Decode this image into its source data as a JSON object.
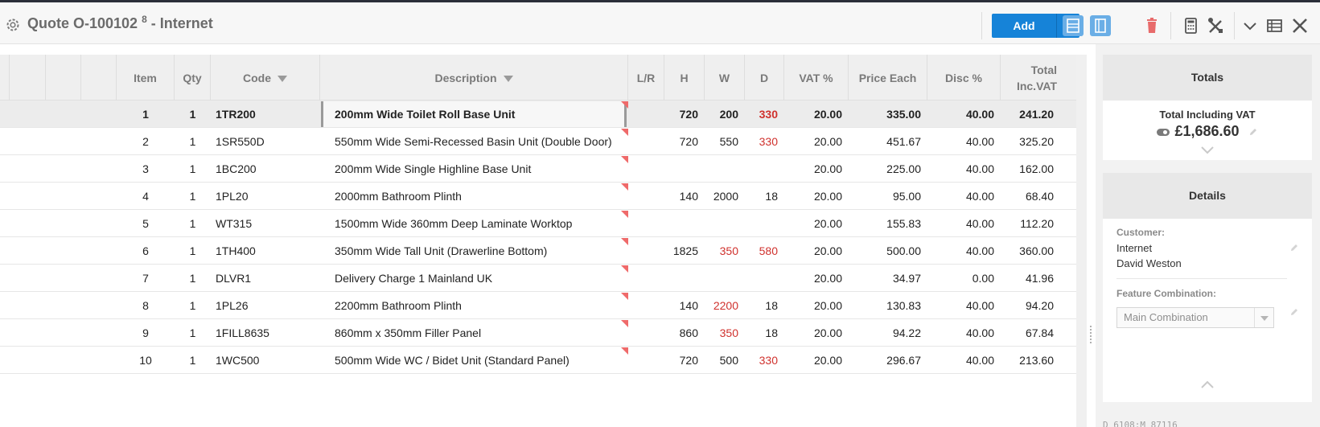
{
  "header": {
    "title": "Quote O-100102",
    "title_sup": "8",
    "title_suffix": "- Internet",
    "add_label": "Add"
  },
  "colors": {
    "accent": "#1683d8",
    "danger_icon": "#e86b6b",
    "highlight_text": "#d0312d"
  },
  "icons": [
    "gear-icon",
    "chevron-down-icon",
    "layout-icon",
    "door-icon",
    "trash-icon",
    "calculator-icon",
    "tools-icon",
    "chevron-down-icon",
    "table-icon",
    "close-icon",
    "pencil-icon",
    "toggle-icon",
    "chevron-up-icon"
  ],
  "grid": {
    "columns": {
      "item": "Item",
      "qty": "Qty",
      "code": "Code",
      "description": "Description",
      "lr": "L/R",
      "h": "H",
      "w": "W",
      "d": "D",
      "vat": "VAT %",
      "price": "Price Each",
      "disc": "Disc %",
      "total": "Total Inc.VAT"
    },
    "rows": [
      {
        "item": "1",
        "qty": "1",
        "code": "1TR200",
        "description": "200mm Wide Toilet Roll Base Unit",
        "lr": "",
        "h": "720",
        "w": "200",
        "d": "330",
        "vat": "20.00",
        "price": "335.00",
        "disc": "40.00",
        "total": "241.20"
      },
      {
        "item": "2",
        "qty": "1",
        "code": "1SR550D",
        "description": "550mm Wide Semi-Recessed Basin Unit (Double Door)",
        "lr": "",
        "h": "720",
        "w": "550",
        "d": "330",
        "vat": "20.00",
        "price": "451.67",
        "disc": "40.00",
        "total": "325.20"
      },
      {
        "item": "3",
        "qty": "1",
        "code": "1BC200",
        "description": "200mm Wide Single Highline Base Unit",
        "lr": "",
        "h": "",
        "w": "",
        "d": "",
        "vat": "20.00",
        "price": "225.00",
        "disc": "40.00",
        "total": "162.00"
      },
      {
        "item": "4",
        "qty": "1",
        "code": "1PL20",
        "description": "2000mm Bathroom Plinth",
        "lr": "",
        "h": "140",
        "w": "2000",
        "d": "18",
        "vat": "20.00",
        "price": "95.00",
        "disc": "40.00",
        "total": "68.40"
      },
      {
        "item": "5",
        "qty": "1",
        "code": "WT315",
        "description": "1500mm Wide 360mm Deep Laminate Worktop",
        "lr": "",
        "h": "",
        "w": "",
        "d": "",
        "vat": "20.00",
        "price": "155.83",
        "disc": "40.00",
        "total": "112.20"
      },
      {
        "item": "6",
        "qty": "1",
        "code": "1TH400",
        "description": "350mm Wide Tall Unit (Drawerline Bottom)",
        "lr": "",
        "h": "1825",
        "w": "350",
        "d": "580",
        "vat": "20.00",
        "price": "500.00",
        "disc": "40.00",
        "total": "360.00"
      },
      {
        "item": "7",
        "qty": "1",
        "code": "DLVR1",
        "description": "Delivery Charge 1 Mainland UK",
        "lr": "",
        "h": "",
        "w": "",
        "d": "",
        "vat": "20.00",
        "price": "34.97",
        "disc": "0.00",
        "total": "41.96"
      },
      {
        "item": "8",
        "qty": "1",
        "code": "1PL26",
        "description": "2200mm Bathroom Plinth",
        "lr": "",
        "h": "140",
        "w": "2200",
        "d": "18",
        "vat": "20.00",
        "price": "130.83",
        "disc": "40.00",
        "total": "94.20"
      },
      {
        "item": "9",
        "qty": "1",
        "code": "1FILL8635",
        "description": "860mm x 350mm Filler Panel",
        "lr": "",
        "h": "860",
        "w": "350",
        "d": "18",
        "vat": "20.00",
        "price": "94.22",
        "disc": "40.00",
        "total": "67.84"
      },
      {
        "item": "10",
        "qty": "1",
        "code": "1WC500",
        "description": "500mm Wide WC / Bidet Unit (Standard Panel)",
        "lr": "",
        "h": "720",
        "w": "500",
        "d": "330",
        "vat": "20.00",
        "price": "296.67",
        "disc": "40.00",
        "total": "213.60"
      }
    ]
  },
  "totals": {
    "heading": "Totals",
    "label": "Total Including VAT",
    "value": "£1,686.60"
  },
  "details": {
    "heading": "Details",
    "customer_label": "Customer:",
    "customer_line1": "Internet",
    "customer_line2": "David Weston",
    "feature_label": "Feature Combination:",
    "feature_value": "Main Combination"
  },
  "footer_code": "D 6108;M 87116"
}
